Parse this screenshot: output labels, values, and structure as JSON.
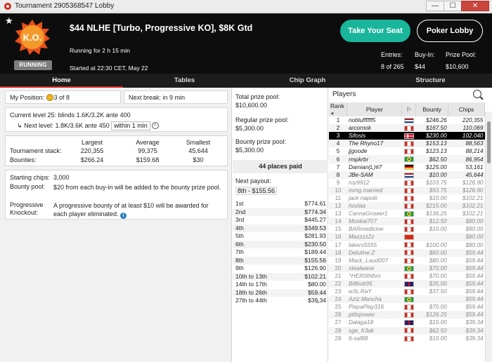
{
  "window": {
    "title": "Tournament 2905368547 Lobby",
    "minimize": "—",
    "maximize": "☐",
    "close": "✕"
  },
  "header": {
    "badge": "RUNNING",
    "logo_text": "K.O.",
    "name": "$44 NLHE [Turbo, Progressive KO], $8K Gtd",
    "running_for": "Running for 2 h 15 min",
    "started": "Started at 22:30 CET, May 22",
    "take_seat": "Take Your Seat",
    "poker_lobby": "Poker Lobby",
    "entries_label": "Entries:",
    "entries_value": "8 of 265",
    "buyin_label": "Buy-In:",
    "buyin_value": "$44",
    "prizepool_label": "Prize Pool:",
    "prizepool_value": "$10,600"
  },
  "tabs": [
    "Home",
    "Tables",
    "Chip Graph",
    "Structure"
  ],
  "home": {
    "my_position_label": "My Position:",
    "my_position_value": "3 of 8",
    "next_break_label": "Next break:",
    "next_break_value": "in 9 min",
    "current_level_label": "Current level 25:",
    "current_level_value": "blinds 1.6K/3.2K ante 400",
    "next_level_label": "Next level:",
    "next_level_value": "1.8K/3.6K ante 450",
    "next_level_time": "within 1 min",
    "stats_headers": [
      "Largest",
      "Average",
      "Smallest"
    ],
    "stack_label": "Tournament stack:",
    "stack_values": [
      "220,355",
      "99,375",
      "45,644"
    ],
    "bounties_label": "Bounties:",
    "bounties_values": [
      "$266.24",
      "$159.68",
      "$30"
    ],
    "starting_chips_label": "Starting chips:",
    "starting_chips_value": "3,000",
    "bounty_pool_label": "Bounty pool:",
    "bounty_pool_value": "$20 from each buy-in will be added to the bounty prize pool.",
    "prog_ko_label": "Progressive Knockout:",
    "prog_ko_value": "A progressive bounty of at least $10 will be awarded for each player eliminated."
  },
  "prizes": {
    "total_label": "Total prize pool:",
    "total_value": "$10,600.00",
    "regular_label": "Regular prize pool:",
    "regular_value": "$5,300.00",
    "bounty_label": "Bounty prize pool:",
    "bounty_value": "$5,300.00",
    "places_paid": "44 places paid",
    "next_payout_label": "Next payout:",
    "next_payout_value": "8th - $155.56",
    "payouts": [
      [
        "1st",
        "$774.61"
      ],
      [
        "2nd",
        "$774.34"
      ],
      [
        "3rd",
        "$445.27"
      ],
      [
        "4th",
        "$349.53"
      ],
      [
        "5th",
        "$281.93"
      ],
      [
        "6th",
        "$230.50"
      ],
      [
        "7th",
        "$189.44"
      ],
      [
        "8th",
        "$155.56"
      ],
      [
        "9th",
        "$126.90"
      ],
      [
        "10th to 13th",
        "$102.21"
      ],
      [
        "14th to 17th",
        "$80.00"
      ],
      [
        "18th to 26th",
        "$59.44"
      ],
      [
        "27th to 44th",
        "$39.34"
      ]
    ]
  },
  "players": {
    "title": "Players",
    "headers": [
      "Rank",
      "Player",
      "",
      "Bounty",
      "Chips"
    ],
    "rows": [
      [
        "1",
        "nobluffffff5",
        "nl",
        "$246.26",
        "220,355",
        "active"
      ],
      [
        "2",
        "arcornok",
        "ca",
        "$167.50",
        "110,069",
        "active"
      ],
      [
        "3",
        "Sifosis",
        "dk",
        "$230.00",
        "102,040",
        "selected"
      ],
      [
        "4",
        "The Rhyno17",
        "ca",
        "$153.13",
        "88,563",
        "active"
      ],
      [
        "5",
        "jjgoode",
        "ca",
        "$123.13",
        "88,214",
        "active"
      ],
      [
        "6",
        "rmpkrbr",
        "br",
        "$62.50",
        "86,954",
        "active"
      ],
      [
        "7",
        "Damian(L)#7",
        "de",
        "$125.00",
        "53,161",
        "active"
      ],
      [
        "8",
        "JBe-SAM",
        "nl",
        "$10.00",
        "45,644",
        "active"
      ],
      [
        "9",
        "roy9912",
        "ca",
        "$103.75",
        "$126.90",
        "elim"
      ],
      [
        "10",
        "mmg.marned",
        "ca",
        "$93.75",
        "$126.90",
        "elim"
      ],
      [
        "11",
        "jack napolii",
        "ca",
        "$10.00",
        "$102.21",
        "elim"
      ],
      [
        "12",
        "hovlaa",
        "ca",
        "$215.00",
        "$102.21",
        "elim"
      ],
      [
        "13",
        "CannaGrower1",
        "br",
        "$136.25",
        "$102.21",
        "elim"
      ],
      [
        "14",
        "Mookai707",
        "ca",
        "$12.50",
        "$80.00",
        "elim"
      ],
      [
        "15",
        "BARmedicine",
        "ca",
        "$10.00",
        "$80.00",
        "elim"
      ],
      [
        "16",
        "Mazzzz2z",
        "cn",
        "",
        "$80.00",
        "elim"
      ],
      [
        "17",
        "lakers5555",
        "ca",
        "$100.00",
        "$80.00",
        "elim"
      ],
      [
        "18",
        "Delutine Z",
        "ca",
        "$60.00",
        "$59.44",
        "elim"
      ],
      [
        "19",
        "Mack_Laud007",
        "ca",
        "$80.00",
        "$59.44",
        "elim"
      ],
      [
        "20",
        "stealwave",
        "br",
        "$70.00",
        "$59.44",
        "elim"
      ],
      [
        "21",
        "^HER0INbro",
        "ca",
        "$70.00",
        "$59.44",
        "elim"
      ],
      [
        "22",
        "Billbob95",
        "gb",
        "$35.00",
        "$59.44",
        "elim"
      ],
      [
        "23",
        "w3c.RaY",
        "ca",
        "$37.50",
        "$59.44",
        "elim"
      ],
      [
        "24",
        "Aziz.Mancha",
        "br",
        "",
        "$59.44",
        "elim"
      ],
      [
        "25",
        "PlayaPlay316",
        "ca",
        "$70.00",
        "$59.44",
        "elim"
      ],
      [
        "26",
        "pittspower",
        "ca",
        "$126.25",
        "$59.44",
        "elim"
      ],
      [
        "27",
        "Dalaga18",
        "gb",
        "$15.00",
        "$39.34",
        "elim"
      ],
      [
        "28",
        "sge_fr3ak",
        "ca",
        "$62.50",
        "$39.34",
        "elim"
      ],
      [
        "29",
        "6-saf88",
        "ca",
        "$10.00",
        "$39.34",
        "elim"
      ]
    ]
  },
  "colors": {
    "accent_green": "#19b69b",
    "brand_red": "#d42a1f",
    "header_bg": "#0d0d0d"
  }
}
